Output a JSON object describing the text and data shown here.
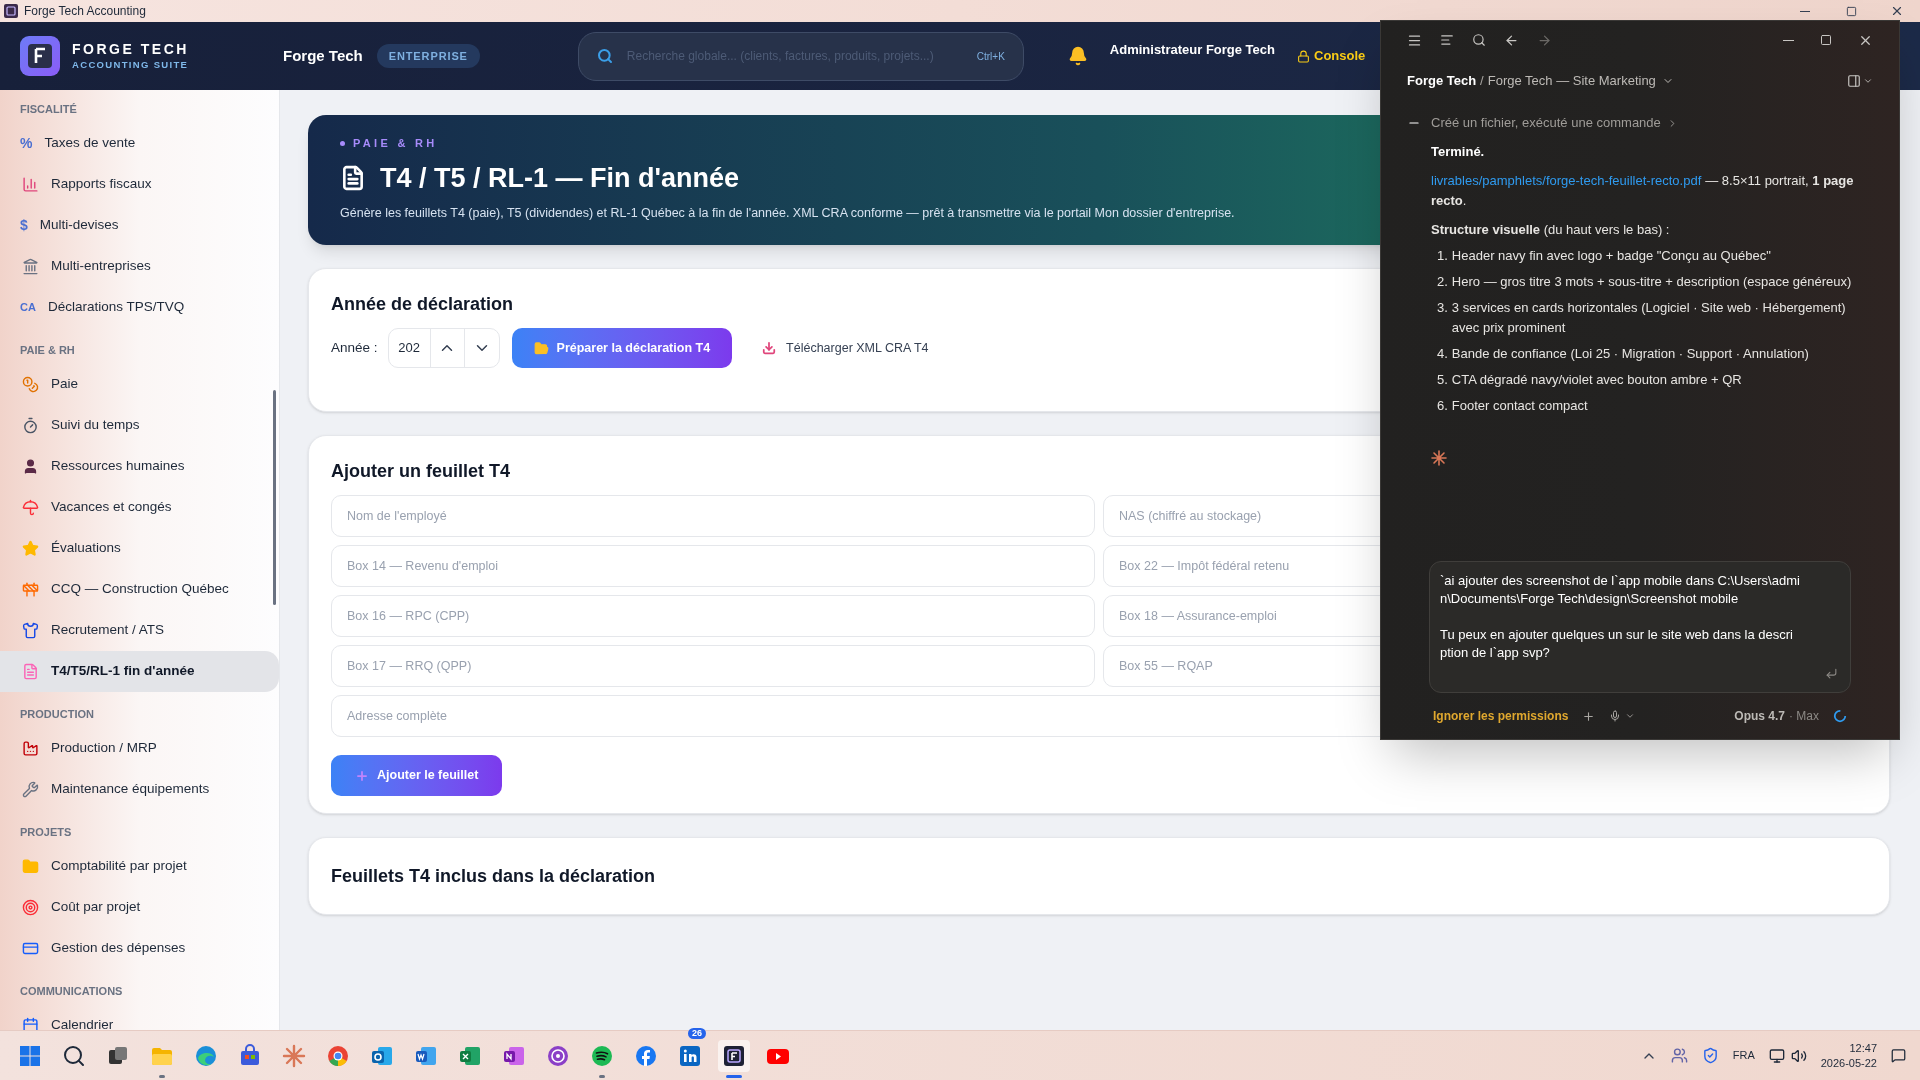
{
  "window": {
    "title": "Forge Tech Accounting"
  },
  "header": {
    "brand": "FORGE TECH",
    "brand_sub": "ACCOUNTING SUITE",
    "company": "Forge Tech",
    "plan_badge": "ENTERPRISE",
    "search": {
      "placeholder": "Recherche globale... (clients, factures, produits, projets...)",
      "shortcut": "Ctrl+K"
    },
    "user": "Administrateur Forge Tech",
    "console": "Console"
  },
  "sidebar": {
    "sections": [
      {
        "title": "FISCALITÉ",
        "items": [
          {
            "label": "Taxes de vente",
            "glyph": "%",
            "selected": false
          },
          {
            "label": "Rapports fiscaux",
            "selected": false
          },
          {
            "label": "Multi-devises",
            "glyph": "$",
            "selected": false
          },
          {
            "label": "Multi-entreprises",
            "selected": false
          },
          {
            "label": "Déclarations TPS/TVQ",
            "glyph": "CA",
            "selected": false
          }
        ]
      },
      {
        "title": "PAIE & RH",
        "items": [
          {
            "label": "Paie",
            "selected": false
          },
          {
            "label": "Suivi du temps",
            "selected": false
          },
          {
            "label": "Ressources humaines",
            "selected": false
          },
          {
            "label": "Vacances et congés",
            "selected": false
          },
          {
            "label": "Évaluations",
            "selected": false
          },
          {
            "label": "CCQ — Construction Québec",
            "selected": false
          },
          {
            "label": "Recrutement / ATS",
            "selected": false
          },
          {
            "label": "T4/T5/RL-1 fin d'année",
            "selected": true
          }
        ]
      },
      {
        "title": "PRODUCTION",
        "items": [
          {
            "label": "Production / MRP",
            "selected": false
          },
          {
            "label": "Maintenance équipements",
            "selected": false
          }
        ]
      },
      {
        "title": "PROJETS",
        "items": [
          {
            "label": "Comptabilité par projet",
            "selected": false
          },
          {
            "label": "Coût par projet",
            "selected": false
          },
          {
            "label": "Gestion des dépenses",
            "selected": false
          }
        ]
      },
      {
        "title": "COMMUNICATIONS",
        "items": [
          {
            "label": "Calendrier",
            "selected": false
          }
        ]
      }
    ]
  },
  "hero": {
    "eyebrow": "PAIE & RH",
    "title": "T4 / T5 / RL-1 — Fin d'année",
    "description": "Génère les feuillets T4 (paie), T5 (dividendes) et RL-1 Québec à la fin de l'année. XML CRA conforme — prêt à transmettre via le portail Mon dossier d'entreprise."
  },
  "year_card": {
    "title": "Année de déclaration",
    "year_label": "Année :",
    "year_value": "202",
    "prepare_button": "Préparer la déclaration T4",
    "download_button": "Télécharger XML CRA T4"
  },
  "add_card": {
    "title": "Ajouter un feuillet T4",
    "fields": [
      {
        "placeholder": "Nom de l'employé",
        "wide": false
      },
      {
        "placeholder": "NAS (chiffré au stockage)",
        "wide": false
      },
      {
        "placeholder": "Box 14 — Revenu d'emploi",
        "wide": false
      },
      {
        "placeholder": "Box 22 — Impôt fédéral retenu",
        "wide": false
      },
      {
        "placeholder": "Box 16 — RPC (CPP)",
        "wide": false
      },
      {
        "placeholder": "Box 18 — Assurance-emploi",
        "wide": false
      },
      {
        "placeholder": "Box 17 — RRQ (QPP)",
        "wide": false
      },
      {
        "placeholder": "Box 55 — RQAP",
        "wide": false
      },
      {
        "placeholder": "Adresse complète",
        "wide": true
      }
    ],
    "submit": "Ajouter le feuillet"
  },
  "list_card": {
    "title": "Feuillets T4 inclus dans la déclaration"
  },
  "assistant": {
    "breadcrumb_root": "Forge Tech",
    "breadcrumb_separator": "/",
    "breadcrumb_project": "Forge Tech — Site Marketing",
    "activity": "Créé un fichier, exécuté une commande",
    "status": "Terminé.",
    "file_link": "livrables/pamphlets/forge-tech-feuillet-recto.pdf",
    "file_note": "— 8.5×11 portrait, **1 page recto**.",
    "structure_heading": "**Structure visuelle** (du haut vers le bas) :",
    "steps": [
      {
        "number": "1.",
        "text": "Header navy fin avec logo + badge \"Conçu au Québec\""
      },
      {
        "number": "2.",
        "text": "Hero — gros titre 3 mots + sous-titre + description (espace généreux)"
      },
      {
        "number": "3.",
        "text": "3 services en cards horizontales (Logiciel · Site web · Hébergement) avec prix prominent"
      },
      {
        "number": "4.",
        "text": "Bande de confiance (Loi 25 · Migration · Support · Annulation)"
      },
      {
        "number": "5.",
        "text": "CTA dégradé navy/violet avec bouton ambre + QR"
      },
      {
        "number": "6.",
        "text": "Footer contact compact"
      }
    ],
    "prompt": "`ai ajouter des screenshot de l`app mobile dans C:\\Users\\admin\\Documents\\Forge Tech\\design\\Screenshot mobile\n\nTu peux en ajouter quelques un sur le site web dans la description de l`app svp?",
    "permissions": "Ignorer les permissions",
    "model": "Opus 4.7",
    "effort": "· Max"
  },
  "taskbar": {
    "apps": [
      {
        "running": false,
        "active": false
      },
      {
        "running": false,
        "active": false
      },
      {
        "running": false,
        "active": false
      },
      {
        "running": true,
        "active": false
      },
      {
        "running": false,
        "active": false
      },
      {
        "running": false,
        "active": false
      },
      {
        "running": false,
        "active": false
      },
      {
        "running": false,
        "active": false
      },
      {
        "running": false,
        "active": false
      },
      {
        "running": false,
        "active": false
      },
      {
        "running": false,
        "active": false
      },
      {
        "running": false,
        "active": false
      },
      {
        "running": false,
        "active": false
      },
      {
        "running": true,
        "active": false
      },
      {
        "running": false,
        "active": false
      },
      {
        "running": false,
        "active": false,
        "badge": "26"
      },
      {
        "running": true,
        "active": true
      },
      {
        "running": false,
        "active": false
      }
    ],
    "language": "FRA",
    "time": "12:47",
    "date": "2026-05-22"
  }
}
